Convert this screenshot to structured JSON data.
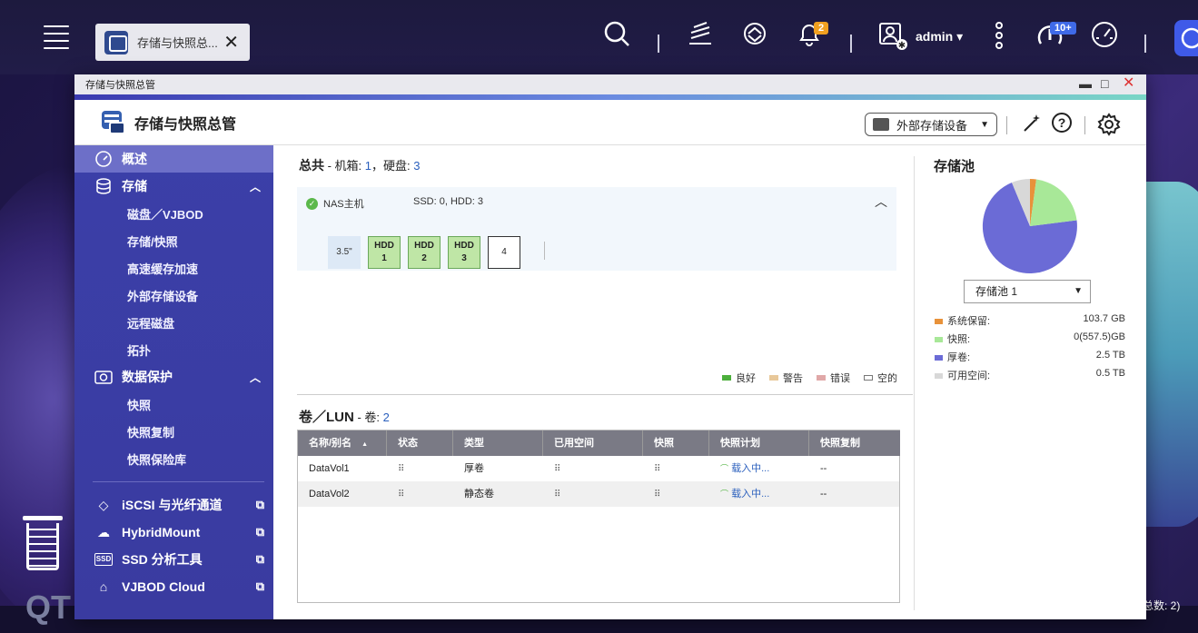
{
  "taskbar": {
    "app_tab_label": "存储与快照总...",
    "notifications_badge": "2",
    "updates_badge": "10+",
    "user": "admin"
  },
  "window": {
    "title": "存储与快照总管",
    "app_title": "存储与快照总管",
    "external_dropdown": "外部存储设备"
  },
  "sidebar": {
    "overview": "概述",
    "storage": "存储",
    "storage_items": [
      "磁盘／VJBOD",
      "存储/快照",
      "高速缓存加速",
      "外部存储设备",
      "远程磁盘",
      "拓扑"
    ],
    "protection": "数据保护",
    "protection_items": [
      "快照",
      "快照复制",
      "快照保险库"
    ],
    "iscsi": "iSCSI 与光纤通道",
    "hybridmount": "HybridMount",
    "ssd_tool": "SSD 分析工具",
    "vjbod_cloud": "VJBOD Cloud"
  },
  "overview": {
    "label_total": "总共",
    "label_enclosure": " - 机箱: ",
    "enclosures": "1",
    "label_disks": "，硬盘: ",
    "disks": "3",
    "nas_name": "NAS主机",
    "disk_summary": "SSD: 0, HDD: 3",
    "form_factor": "3.5\"",
    "slots": [
      {
        "type": "HDD",
        "num": "1"
      },
      {
        "type": "HDD",
        "num": "2"
      },
      {
        "type": "HDD",
        "num": "3"
      },
      {
        "type": "",
        "num": "4"
      }
    ],
    "legend": [
      "良好",
      "警告",
      "错误",
      "空的"
    ],
    "legend_colors": [
      "#4caf3c",
      "#e8c89a",
      "#e0a8a8",
      "#ffffff"
    ]
  },
  "volumes": {
    "title": "卷／LUN",
    "label_count": " - 卷: ",
    "count": "2",
    "headers": [
      "名称/别名",
      "状态",
      "类型",
      "已用空间",
      "快照",
      "快照计划",
      "快照复制"
    ],
    "sort_indicator": "▲",
    "rows": [
      {
        "name": "DataVol1",
        "type": "厚卷",
        "schedule": "载入中...",
        "replication": "--"
      },
      {
        "name": "DataVol2",
        "type": "静态卷",
        "schedule": "载入中...",
        "replication": "--"
      }
    ]
  },
  "pool": {
    "title": "存储池",
    "selected": "存储池 1",
    "legend": [
      {
        "label": "系统保留:",
        "value": "103.7 GB",
        "color": "#e8923a"
      },
      {
        "label": "快照:",
        "value": "0(557.5)GB",
        "color": "#a8e898"
      },
      {
        "label": "厚卷:",
        "value": "2.5 TB",
        "color": "#6b6bd6"
      },
      {
        "label": "可用空间:",
        "value": "0.5 TB",
        "color": "#d8d8d8"
      }
    ]
  },
  "desktop": {
    "footer_text": "总数: 2)",
    "brand_text": "QT"
  }
}
